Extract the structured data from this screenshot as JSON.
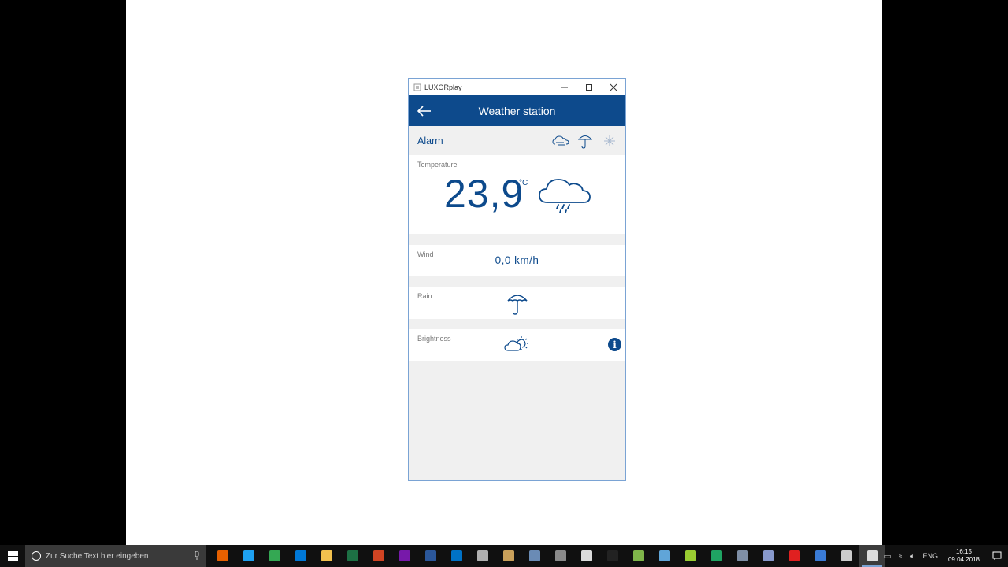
{
  "window": {
    "title": "LUXORplay"
  },
  "header": {
    "title": "Weather station"
  },
  "alarm": {
    "label": "Alarm",
    "icons": [
      "wind-alarm-icon",
      "rain-alarm-icon",
      "frost-alarm-icon"
    ]
  },
  "temperature": {
    "label": "Temperature",
    "value": "23,9",
    "unit": "°C",
    "condition_icon": "rain-cloud-icon"
  },
  "wind": {
    "label": "Wind",
    "value": "0,0 km/h"
  },
  "rain": {
    "label": "Rain",
    "icon": "umbrella-icon"
  },
  "brightness": {
    "label": "Brightness",
    "icon": "partly-sunny-icon",
    "info_label": "i"
  },
  "taskbar": {
    "search_placeholder": "Zur Suche Text hier eingeben",
    "apps": [
      {
        "name": "firefox",
        "color": "#e66000"
      },
      {
        "name": "ie",
        "color": "#1ea1f1"
      },
      {
        "name": "chrome",
        "color": "#34a853"
      },
      {
        "name": "edge",
        "color": "#0078d7"
      },
      {
        "name": "explorer",
        "color": "#f2c14e"
      },
      {
        "name": "excel",
        "color": "#1d7044"
      },
      {
        "name": "powerpoint",
        "color": "#d04423"
      },
      {
        "name": "onenote",
        "color": "#7719aa"
      },
      {
        "name": "word",
        "color": "#2b579a"
      },
      {
        "name": "outlook",
        "color": "#0072c6"
      },
      {
        "name": "paint",
        "color": "#b0b0b0"
      },
      {
        "name": "media",
        "color": "#c9a05a"
      },
      {
        "name": "keepass",
        "color": "#6a8bb5"
      },
      {
        "name": "calculator",
        "color": "#8a8a8a"
      },
      {
        "name": "home",
        "color": "#dcdcdc"
      },
      {
        "name": "terminal",
        "color": "#222222"
      },
      {
        "name": "notepad-green",
        "color": "#7fb54a"
      },
      {
        "name": "snowflake-app",
        "color": "#60a5d8"
      },
      {
        "name": "notepad-plus",
        "color": "#9acd32"
      },
      {
        "name": "sheets",
        "color": "#1fa463"
      },
      {
        "name": "network",
        "color": "#7f8fa6"
      },
      {
        "name": "printer",
        "color": "#8899cc"
      },
      {
        "name": "record",
        "color": "#e02020"
      },
      {
        "name": "monitor",
        "color": "#3a7bd5"
      },
      {
        "name": "draw",
        "color": "#cccccc"
      },
      {
        "name": "luxorplay",
        "color": "#dddddd"
      }
    ],
    "language": "ENG",
    "time": "16:15",
    "date": "09.04.2018"
  }
}
